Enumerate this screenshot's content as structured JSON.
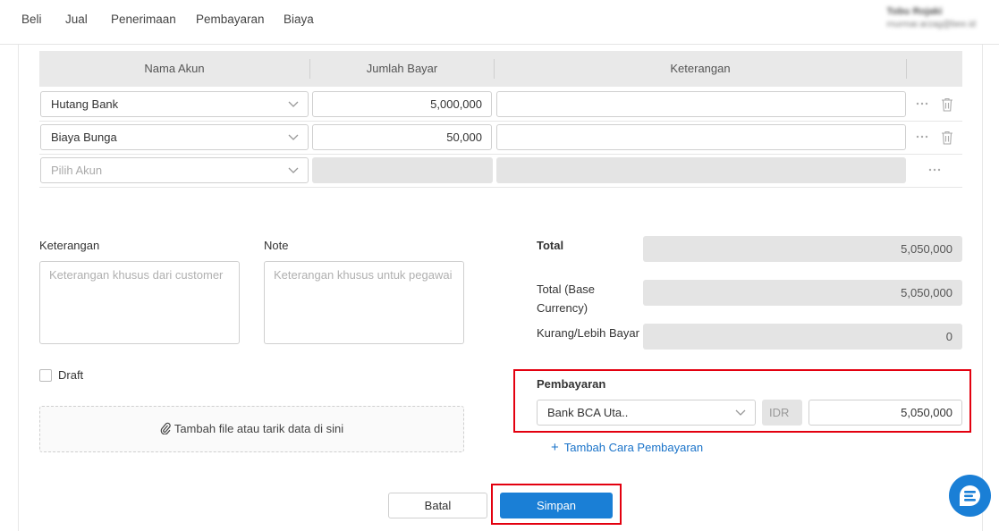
{
  "nav": {
    "items": [
      "Beli",
      "Jual",
      "Penerimaan",
      "Pembayaran",
      "Biaya"
    ]
  },
  "user": {
    "name": "Tobu Rojaki",
    "email": "rnurmar.arzag@bee.id"
  },
  "table": {
    "headers": {
      "account": "Nama Akun",
      "amount": "Jumlah Bayar",
      "note": "Keterangan"
    },
    "rows": [
      {
        "account": "Hutang Bank",
        "amount": "5,000,000",
        "note": ""
      },
      {
        "account": "Biaya Bunga",
        "amount": "50,000",
        "note": ""
      }
    ],
    "new_row_placeholder": "Pilih Akun"
  },
  "form": {
    "keterangan_label": "Keterangan",
    "keterangan_placeholder": "Keterangan khusus dari customer",
    "note_label": "Note",
    "note_placeholder": "Keterangan khusus untuk pegawai",
    "draft_label": "Draft",
    "dropzone_text": "Tambah file atau tarik data di sini"
  },
  "totals": {
    "total_label": "Total",
    "total_value": "5,050,000",
    "base_label_line1": "Total (Base",
    "base_label_line2": "Currency)",
    "base_value": "5,050,000",
    "diff_label": "Kurang/Lebih Bayar",
    "diff_value": "0"
  },
  "payment": {
    "title": "Pembayaran",
    "method": "Bank BCA Uta..",
    "currency": "IDR",
    "amount": "5,050,000",
    "add_label": "Tambah Cara Pembayaran"
  },
  "actions": {
    "cancel_label": "Batal",
    "save_label": "Simpan"
  },
  "colors": {
    "primary": "#1a7fd6",
    "highlight": "#e3000f",
    "link": "#1a73c9"
  }
}
